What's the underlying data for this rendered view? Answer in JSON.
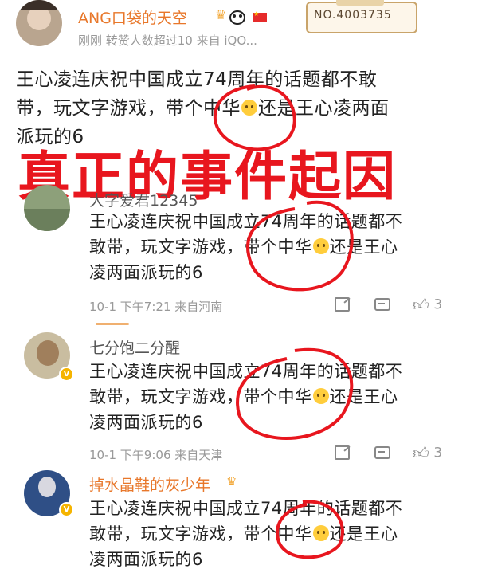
{
  "post": {
    "username": "ANG口袋的天空",
    "badge_no": "NO.4003735",
    "meta": "刚刚 转赞人数超过10 来自 iQO...",
    "text_a": "王心凌连庆祝中国成立74周年的话题都不敢",
    "text_b1": "带，玩文字游戏，带个中华",
    "text_b2": "还是王心凌两面",
    "text_c": "派玩的6"
  },
  "overlay_caption": "真正的事件起因",
  "comments": [
    {
      "username": "大字爱君12345",
      "line1": "王心凌连庆祝中国成立74周年的话题都不",
      "line2a": "敢带，玩文字游戏，带个中华",
      "line2b": "还是王心",
      "line3": "凌两面派玩的6",
      "meta": "10-1 下午7:21 来自河南",
      "likes": "3"
    },
    {
      "username": "七分饱二分醒",
      "line1": "王心凌连庆祝中国成立74周年的话题都不",
      "line2a": "敢带，玩文字游戏，带个中华",
      "line2b": "还是王心",
      "line3": "凌两面派玩的6",
      "meta": "10-1 下午9:06 来自天津",
      "likes": "3"
    },
    {
      "username": "掉水晶鞋的灰少年",
      "line1": "王心凌连庆祝中国成立74周年的话题都不",
      "line2a": "敢带，玩文字游戏，带个中华",
      "line2b": "还是王心",
      "line3": "凌两面派玩的6"
    }
  ],
  "icons": [
    "crown-icon",
    "panda-icon",
    "china-flag-icon",
    "verified-badge-icon",
    "share-icon",
    "comment-icon",
    "like-icon",
    "emoji-icon"
  ],
  "colors": {
    "overlay_red": "#e8161e",
    "username_orange": "#e8772a",
    "meta_gray": "#999999"
  }
}
